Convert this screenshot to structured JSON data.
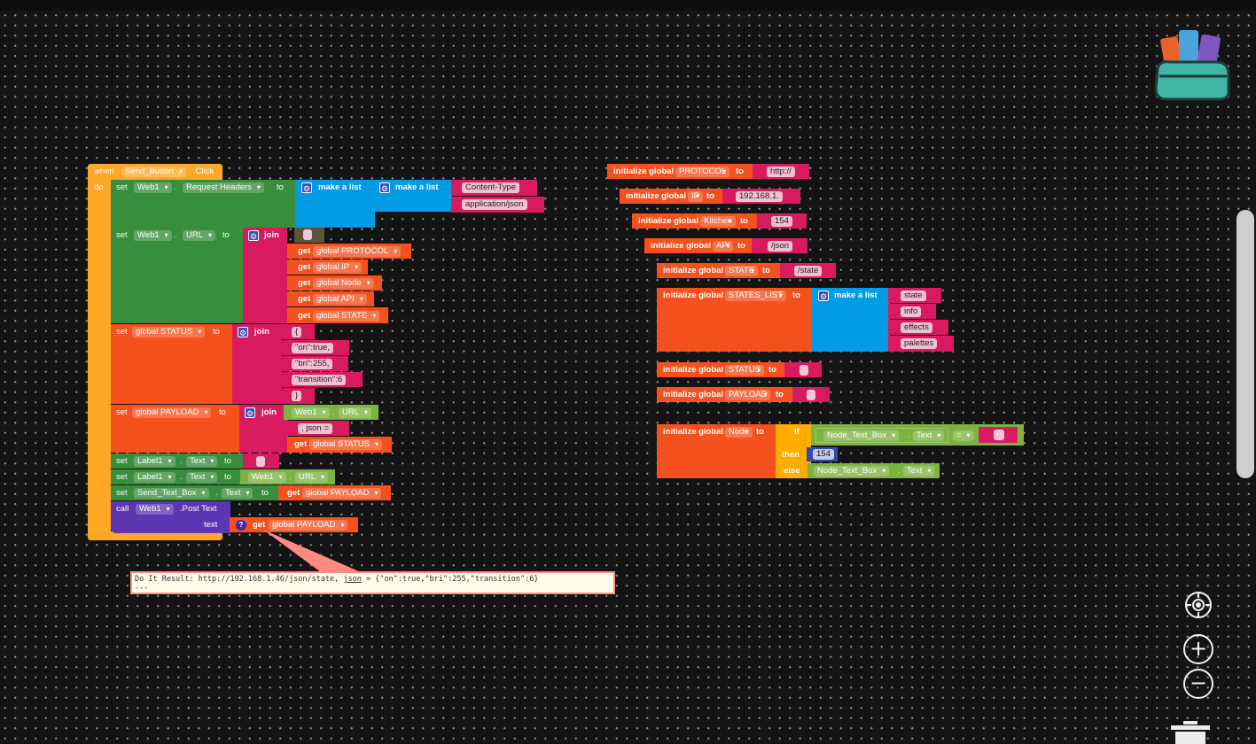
{
  "event": {
    "when": "when",
    "component": "Send_Button",
    "event": ".Click",
    "do": "do"
  },
  "stmt1": {
    "set": "set",
    "comp": "Web1",
    "prop": "Request Headers",
    "to": "to",
    "make_list_outer": "make a list",
    "make_list_inner": "make a list",
    "item1": "Content-Type",
    "item2": "application/json"
  },
  "stmt2": {
    "set": "set",
    "comp": "Web1",
    "prop": "URL",
    "to": "to",
    "join": "join",
    "sep": " ",
    "gets": [
      {
        "get": "get",
        "var": "global PROTOCOL"
      },
      {
        "get": "get",
        "var": "global IP"
      },
      {
        "get": "get",
        "var": "global Node"
      },
      {
        "get": "get",
        "var": "global API"
      },
      {
        "get": "get",
        "var": "global STATE"
      }
    ]
  },
  "stmt3": {
    "set": "set",
    "var": "global STATUS",
    "to": "to",
    "join": "join",
    "parts": [
      "{",
      "\"on\":true,",
      "\"bri\":255,",
      "\"transition\":6",
      "}"
    ]
  },
  "stmt4": {
    "set": "set",
    "var": "global PAYLOAD",
    "to": "to",
    "join": "join",
    "comp": "Web1",
    "prop": "URL",
    "lit": ", json = ",
    "get": "get",
    "getvar": "global STATUS"
  },
  "stmt5": {
    "set": "set",
    "comp": "Label1",
    "prop": "Text",
    "to": "to",
    "lit": " "
  },
  "stmt6": {
    "set": "set",
    "comp": "Label1",
    "prop": "Text",
    "to": "to",
    "vcomp": "Web1",
    "vprop": "URL"
  },
  "stmt7": {
    "set": "set",
    "comp": "Send_Text_Box",
    "prop": "Text",
    "to": "to",
    "get": "get",
    "getvar": "global PAYLOAD"
  },
  "stmt8": {
    "call": "call",
    "comp": "Web1",
    "method": ".Post Text",
    "arg": "text",
    "q": "?",
    "get": "get",
    "getvar": "global PAYLOAD"
  },
  "globals": [
    {
      "init": "initialize global",
      "name": "PROTOCOL",
      "to": "to",
      "value": "http://"
    },
    {
      "init": "initialize global",
      "name": "IP",
      "to": "to",
      "value": "192.168.1."
    },
    {
      "init": "initialize global",
      "name": "Kitchen",
      "to": "to",
      "value": "154"
    },
    {
      "init": "initialize global",
      "name": "API",
      "to": "to",
      "value": "/json"
    },
    {
      "init": "initialize global",
      "name": "STATE",
      "to": "to",
      "value": "/state"
    }
  ],
  "states_list": {
    "init": "initialize global",
    "name": "STATES_LIST",
    "to": "to",
    "make_list": "make a list",
    "items": [
      "state",
      "info",
      "effects",
      "palettes"
    ]
  },
  "status_global": {
    "init": "initialize global",
    "name": "STATUS",
    "to": "to",
    "value": " "
  },
  "payload_global": {
    "init": "initialize global",
    "name": "PAYLOAD",
    "to": "to",
    "value": " "
  },
  "node_global": {
    "init": "initialize global",
    "name": "Node",
    "to": "to",
    "if": "if",
    "then": "then",
    "else": "else",
    "cond_comp": "Node_Text_Box",
    "cond_prop": "Text",
    "op": "=",
    "then_num": "154",
    "else_comp": "Node_Text_Box",
    "else_prop": "Text"
  },
  "result": {
    "prefix": "Do It Result: http://192.168.1.46/json/state, ",
    "json": "json",
    "suffix": " = {\"on\":true,\"bri\":255,\"transition\":6}",
    "line2": "---"
  },
  "controls": {
    "recenter_icon": "target-icon",
    "zoom_in": "+",
    "zoom_out": "−"
  }
}
